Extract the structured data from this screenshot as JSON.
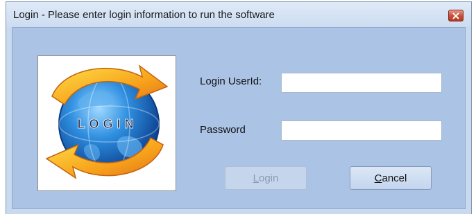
{
  "window": {
    "title": "Login - Please enter login information to run the software",
    "close_icon": "close-icon"
  },
  "logo": {
    "icon": "login-globe-logo",
    "text": "LOGIN"
  },
  "form": {
    "userid_label": "Login UserId:",
    "userid_value": "",
    "password_label": "Password",
    "password_value": ""
  },
  "buttons": {
    "login_label": "Login",
    "login_enabled": false,
    "cancel_label": "Cancel"
  },
  "colors": {
    "client_background": "#abc4e6",
    "titlebar": "#d6e3f4",
    "close_button": "#c9513c"
  }
}
